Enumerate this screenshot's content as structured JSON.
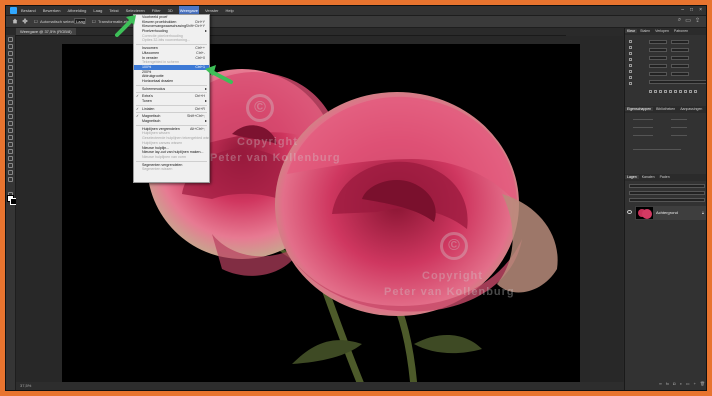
{
  "menubar": {
    "items": [
      "Bestand",
      "Bewerken",
      "Afbeelding",
      "Laag",
      "Tekst",
      "Selecteren",
      "Filter",
      "3D",
      "Weergave",
      "Venster",
      "Help"
    ],
    "active_index": 8
  },
  "options_bar": {
    "auto_select_label": "Automatisch selecteren:",
    "auto_select_value": "Laag",
    "transform_label": "Transformatie-elementen"
  },
  "document": {
    "tab_title": "Weergave @ 37,5% (RGB/8)"
  },
  "view_menu": {
    "items": [
      {
        "label": "Voorbeeld proef",
        "shortcut": "",
        "disabled": false,
        "sep_after": false
      },
      {
        "label": "Kleuren proefdrukken",
        "shortcut": "Ctrl+Y",
        "disabled": false,
        "sep_after": false
      },
      {
        "label": "Kleuromvangwaarschuwing",
        "shortcut": "Shift+Ctrl+Y",
        "disabled": false,
        "sep_after": false
      },
      {
        "label": "Pixelverhouding",
        "shortcut": "",
        "disabled": false,
        "sep_after": false,
        "submenu": true
      },
      {
        "label": "Correctie pixelverhouding",
        "shortcut": "",
        "disabled": true,
        "sep_after": false
      },
      {
        "label": "Opties 32-bits voorvertoning...",
        "shortcut": "",
        "disabled": true,
        "sep_after": true
      },
      {
        "label": "Inzoomen",
        "shortcut": "Ctrl++",
        "disabled": false,
        "sep_after": false
      },
      {
        "label": "Uitzoomen",
        "shortcut": "Ctrl+-",
        "disabled": false,
        "sep_after": false
      },
      {
        "label": "In venster",
        "shortcut": "Ctrl+0",
        "disabled": false,
        "sep_after": false
      },
      {
        "label": "Tekengebied in scherm",
        "shortcut": "",
        "disabled": true,
        "sep_after": false
      },
      {
        "label": "100%",
        "shortcut": "Ctrl+1",
        "disabled": false,
        "sep_after": false,
        "highlight": true
      },
      {
        "label": "200%",
        "shortcut": "",
        "disabled": false,
        "sep_after": false
      },
      {
        "label": "Afdrukgrootte",
        "shortcut": "",
        "disabled": false,
        "sep_after": false
      },
      {
        "label": "Horizontaal draaien",
        "shortcut": "",
        "disabled": false,
        "sep_after": true
      },
      {
        "label": "Schermmodus",
        "shortcut": "",
        "disabled": false,
        "sep_after": true,
        "submenu": true
      },
      {
        "label": "Extra's",
        "shortcut": "Ctrl+H",
        "disabled": false,
        "sep_after": false,
        "check": true
      },
      {
        "label": "Tonen",
        "shortcut": "",
        "disabled": false,
        "sep_after": true,
        "submenu": true
      },
      {
        "label": "Linialen",
        "shortcut": "Ctrl+R",
        "disabled": false,
        "sep_after": true,
        "check": true
      },
      {
        "label": "Magnetisch",
        "shortcut": "Shift+Ctrl+;",
        "disabled": false,
        "sep_after": false,
        "check": true
      },
      {
        "label": "Magnetisch",
        "shortcut": "",
        "disabled": false,
        "sep_after": true,
        "submenu": true
      },
      {
        "label": "Hulplijnen vergrendelen",
        "shortcut": "Alt+Ctrl+;",
        "disabled": false,
        "sep_after": false
      },
      {
        "label": "Hulplijnen wissen",
        "shortcut": "",
        "disabled": true,
        "sep_after": false
      },
      {
        "label": "Geselecteerde hulplijnen tekengebied wissen",
        "shortcut": "",
        "disabled": true,
        "sep_after": false
      },
      {
        "label": "Hulplijnen canvas wissen",
        "shortcut": "",
        "disabled": true,
        "sep_after": false
      },
      {
        "label": "Nieuwe hulplijn...",
        "shortcut": "",
        "disabled": false,
        "sep_after": false
      },
      {
        "label": "Nieuwe lay-out van hulplijnen maken...",
        "shortcut": "",
        "disabled": false,
        "sep_after": false
      },
      {
        "label": "Nieuwe hulplijnen van vorm",
        "shortcut": "",
        "disabled": true,
        "sep_after": true
      },
      {
        "label": "Segmenten vergrendelen",
        "shortcut": "",
        "disabled": false,
        "sep_after": false
      },
      {
        "label": "Segmenten wissen",
        "shortcut": "",
        "disabled": true,
        "sep_after": false
      }
    ]
  },
  "watermark": {
    "line1": "Copyright",
    "line2": "Peter van Kollenburg",
    "symbol": "©"
  },
  "status_bar": {
    "zoom": "37,5%"
  },
  "right_panel": {
    "top_tabs": [
      "Kleur",
      "Stalen",
      "Verlopen",
      "Patronen"
    ],
    "props_tabs": [
      "Eigenschappen",
      "Bibliotheken",
      "Aanpassingen"
    ],
    "layers_tabs": [
      "Lagen",
      "Kanalen",
      "Paden"
    ],
    "layer_name": "Achtergrond"
  },
  "colors": {
    "orange_border": "#e8742f",
    "highlight": "#3d7ad6",
    "arrow_green": "#3dbf58",
    "rose": "#d23a63"
  }
}
